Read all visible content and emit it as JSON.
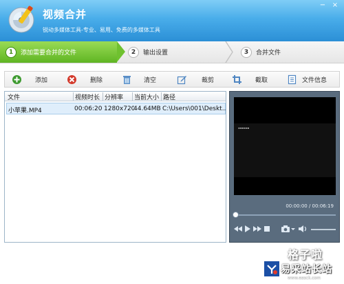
{
  "app": {
    "title": "视频合并",
    "subtitle": "锐动多媒体工具-专业、易用、免费的多媒体工具"
  },
  "window_controls": {
    "minimize": "−",
    "close": "×"
  },
  "steps": [
    {
      "num": "1",
      "label": "添加需要合并的文件",
      "active": true
    },
    {
      "num": "2",
      "label": "输出设置",
      "active": false
    },
    {
      "num": "3",
      "label": "合并文件",
      "active": false
    }
  ],
  "toolbar": {
    "add": "添加",
    "delete": "删除",
    "clear": "清空",
    "crop": "裁剪",
    "cut": "截取",
    "info": "文件信息"
  },
  "table": {
    "columns": [
      "文件",
      "视频时长",
      "分辨率",
      "当前大小",
      "路径"
    ],
    "rows": [
      {
        "file": "小苹果.MP4",
        "duration": "00:06:20",
        "resolution": "1280x720",
        "size": "44.64MB",
        "path": "C:\\Users\\001\\Deskt..."
      }
    ]
  },
  "player": {
    "time": "00:00:00 / 00:06:19",
    "progress": 0
  },
  "watermark": {
    "text": "格子啦",
    "site": "易采站长站",
    "url": "www.easck.com"
  },
  "colors": {
    "header_blue": "#2b8fd6",
    "step_active_green": "#5fb523",
    "row_selected": "#dfeefb",
    "preview_bg": "#5a6c7e"
  }
}
